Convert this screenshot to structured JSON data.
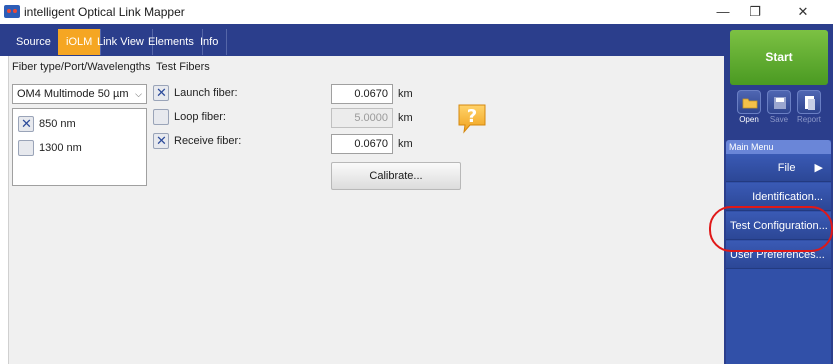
{
  "window": {
    "title": "intelligent Optical Link Mapper"
  },
  "tabs": [
    "Source",
    "iOLM",
    "Link View",
    "Elements",
    "Info"
  ],
  "active_tab": "iOLM",
  "left_panel": {
    "heading": "Fiber type/Port/Wavelengths",
    "fiber_type": "OM4 Multimode 50 µm",
    "wavelengths": [
      {
        "label": "850 nm",
        "checked": true
      },
      {
        "label": "1300 nm",
        "checked": false
      }
    ]
  },
  "test_fibers": {
    "heading": "Test Fibers",
    "launch": {
      "label": "Launch fiber:",
      "checked": true,
      "value": "0.0670",
      "unit": "km"
    },
    "loop": {
      "label": "Loop fiber:",
      "checked": false,
      "value": "5.0000",
      "unit": "km"
    },
    "receive": {
      "label": "Receive fiber:",
      "checked": true,
      "value": "0.0670",
      "unit": "km"
    },
    "calibrate_label": "Calibrate..."
  },
  "sidebar": {
    "start_label": "Start",
    "tools": [
      {
        "label": "Open"
      },
      {
        "label": "Save"
      },
      {
        "label": "Report"
      }
    ],
    "menu_header": "Main Menu",
    "menu_items": [
      {
        "label": "File"
      },
      {
        "label": "Identification..."
      },
      {
        "label": "Test Configuration..."
      },
      {
        "label": "User Preferences..."
      }
    ]
  },
  "colors": {
    "accent": "#f5a623",
    "brand": "#2b3e8c",
    "start": "#5aa82c",
    "highlight": "#e01818"
  }
}
